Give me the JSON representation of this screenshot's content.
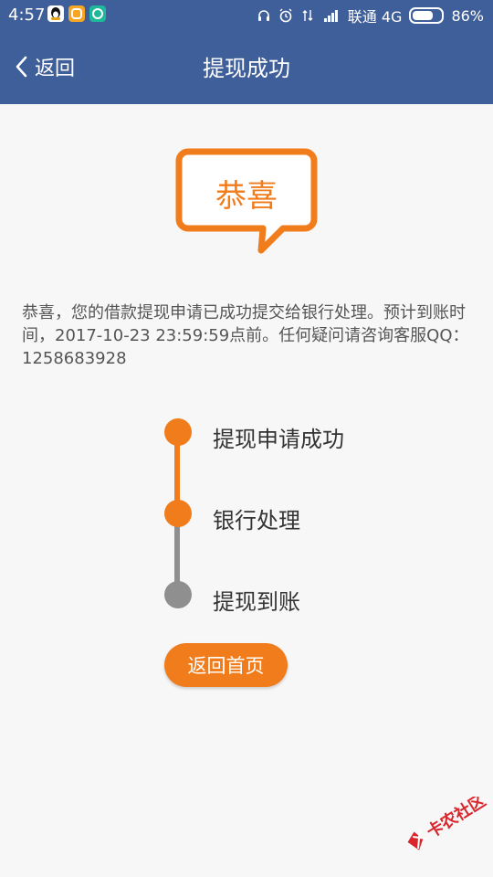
{
  "status": {
    "time": "4:57",
    "carrier": "联通 4G",
    "battery": "86%",
    "battery_level": 0.86
  },
  "nav": {
    "back_label": "返回",
    "title": "提现成功"
  },
  "badge": {
    "text": "恭喜"
  },
  "message": "恭喜，您的借款提现申请已成功提交给银行处理。预计到账时间，2017-10-23 23:59:59点前。任何疑问请咨询客服QQ：1258683928",
  "steps": [
    {
      "label": "提现申请成功",
      "state": "done"
    },
    {
      "label": "银行处理",
      "state": "current"
    },
    {
      "label": "提现到账",
      "state": "pending"
    }
  ],
  "home_button": "返回首页",
  "watermark": "卡农社区",
  "colors": {
    "nav": "#3f5f9a",
    "accent": "#f07c1b",
    "pending": "#8f8f8f"
  }
}
